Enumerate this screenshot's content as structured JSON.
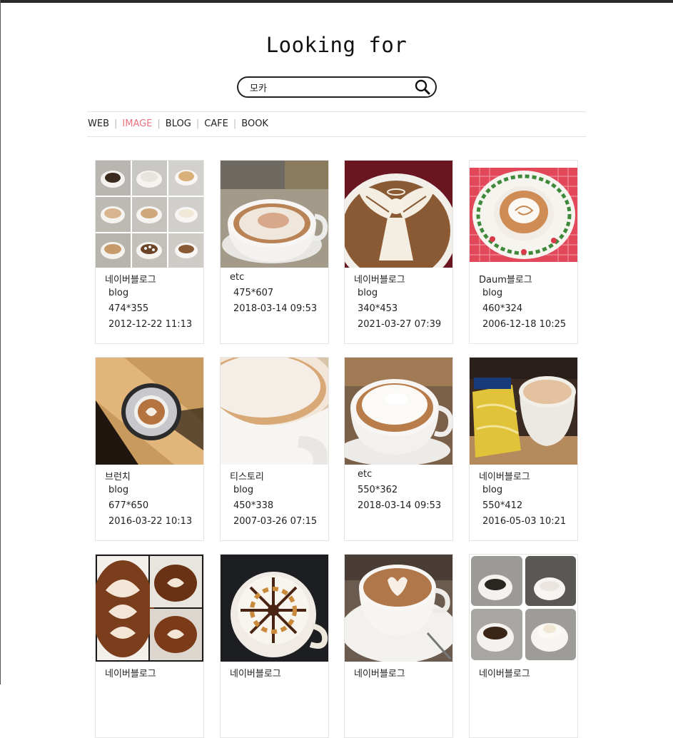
{
  "page": {
    "title": "Looking for"
  },
  "search": {
    "value": "모카"
  },
  "nav": {
    "web": "WEB",
    "image": "IMAGE",
    "blog": "BLOG",
    "cafe": "CAFE",
    "book": "BOOK",
    "sep": "|"
  },
  "results": [
    {
      "source": "네이버블로그",
      "lines": [
        "blog",
        "474*355",
        "2012-12-22 11:13"
      ],
      "thumb": "grid9"
    },
    {
      "source": "etc",
      "lines": [
        "475*607",
        "2018-03-14 09:53",
        ""
      ],
      "thumb": "cup-side"
    },
    {
      "source": "네이버블로그",
      "lines": [
        "blog",
        "340*453",
        "2021-03-27 07:39"
      ],
      "thumb": "angel"
    },
    {
      "source": "Daum블로그",
      "lines": [
        "blog",
        "460*324",
        "2006-12-18 10:25"
      ],
      "thumb": "plate"
    },
    {
      "source": "브런치",
      "lines": [
        "blog",
        "677*650",
        "2016-03-22 10:13"
      ],
      "thumb": "top-saucer"
    },
    {
      "source": "티스토리",
      "lines": [
        "blog",
        "450*338",
        "2007-03-26 07:15"
      ],
      "thumb": "closeup"
    },
    {
      "source": "etc",
      "lines": [
        "550*362",
        "2018-03-14 09:53",
        ""
      ],
      "thumb": "foam"
    },
    {
      "source": "네이버블로그",
      "lines": [
        "blog",
        "550*412",
        "2016-05-03 10:21"
      ],
      "thumb": "jars"
    },
    {
      "source": "네이버블로그",
      "lines": [
        "",
        "",
        ""
      ],
      "thumb": "hearts"
    },
    {
      "source": "네이버블로그",
      "lines": [
        "",
        "",
        ""
      ],
      "thumb": "star"
    },
    {
      "source": "네이버블로그",
      "lines": [
        "",
        "",
        ""
      ],
      "thumb": "heart-cup"
    },
    {
      "source": "네이버블로그",
      "lines": [
        "",
        "",
        ""
      ],
      "thumb": "grid4"
    }
  ]
}
